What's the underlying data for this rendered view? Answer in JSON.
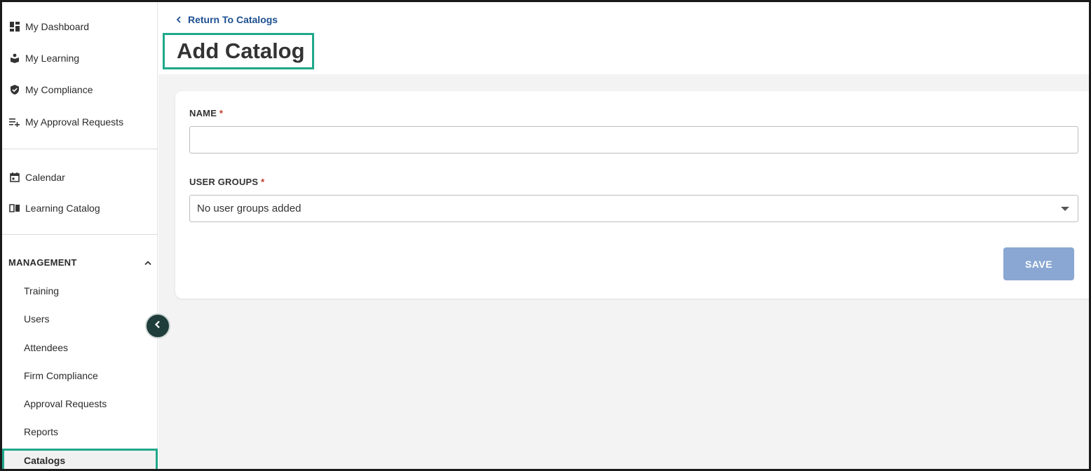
{
  "sidebar": {
    "primary": [
      {
        "label": "My Dashboard",
        "icon": "dashboard-icon"
      },
      {
        "label": "My Learning",
        "icon": "learning-icon"
      },
      {
        "label": "My Compliance",
        "icon": "shield-check-icon"
      },
      {
        "label": "My Approval Requests",
        "icon": "playlist-add-icon"
      }
    ],
    "secondary": [
      {
        "label": "Calendar",
        "icon": "calendar-icon"
      },
      {
        "label": "Learning Catalog",
        "icon": "book-open-icon"
      }
    ],
    "management": {
      "heading": "MANAGEMENT",
      "expanded": true,
      "items": [
        "Training",
        "Users",
        "Attendees",
        "Firm Compliance",
        "Approval Requests",
        "Reports",
        "Catalogs"
      ],
      "active": "Catalogs"
    }
  },
  "header": {
    "back_link": "Return To Catalogs",
    "title": "Add Catalog"
  },
  "form": {
    "name_label": "NAME",
    "required_mark": "*",
    "name_value": "",
    "groups_label": "USER GROUPS",
    "groups_value": "No user groups added",
    "save_label": "SAVE"
  },
  "colors": {
    "highlight": "#1fa88a",
    "link": "#1d4f91",
    "save_button": "#8aa7d3",
    "collapse_button": "#1f3d3a"
  }
}
